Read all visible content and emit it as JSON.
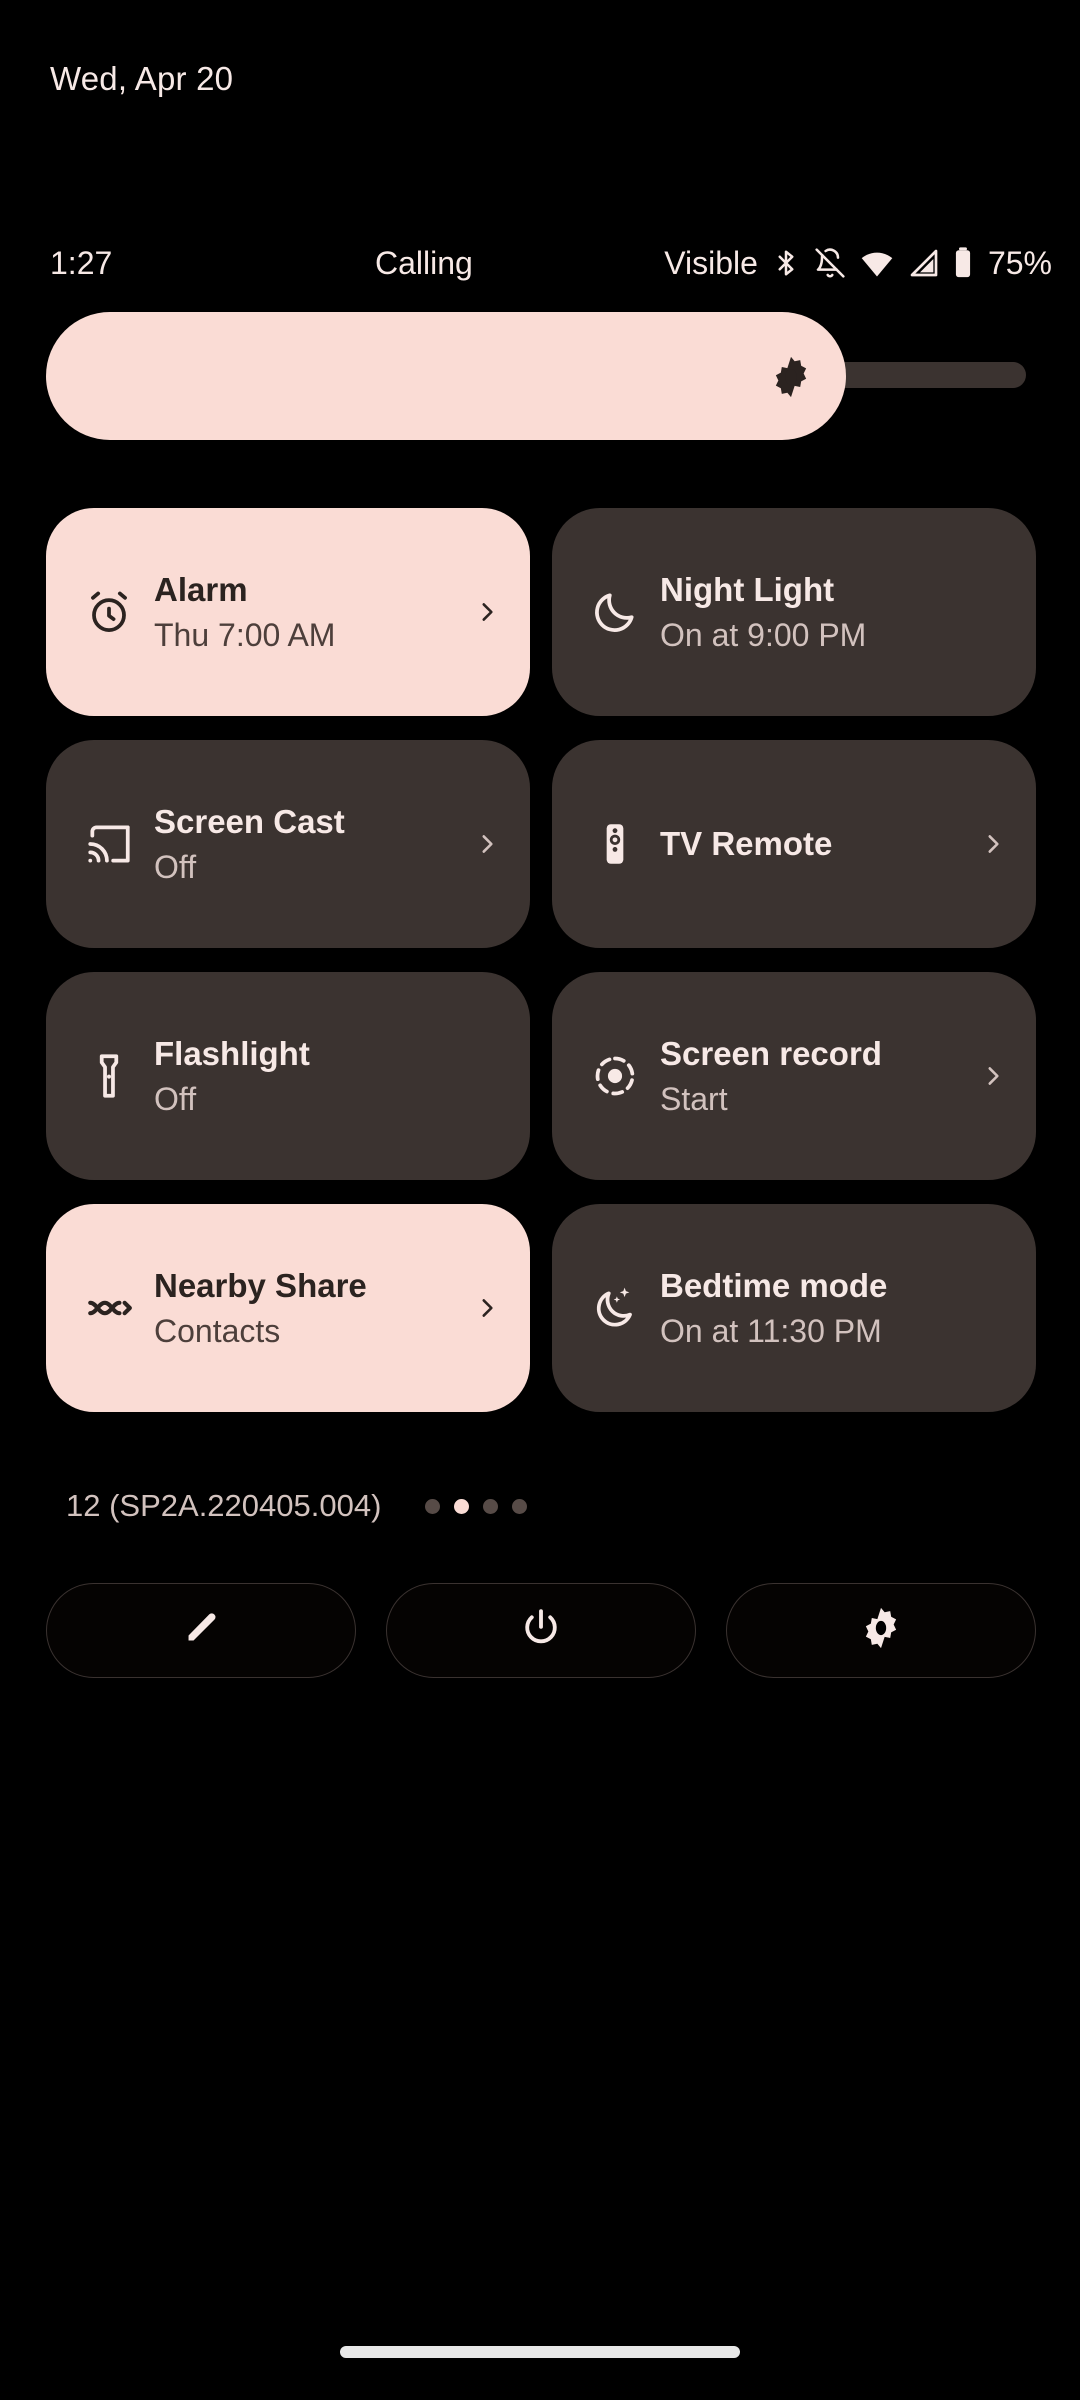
{
  "date_header": "Wed, Apr 20",
  "status_bar": {
    "clock": "1:27",
    "calling_label": "Calling",
    "carrier": "Visible",
    "battery_percent": "75%",
    "icons": [
      "bluetooth-icon",
      "notifications-muted-icon",
      "wifi-icon",
      "cellular-signal-icon",
      "battery-icon"
    ]
  },
  "brightness": {
    "icon": "brightness-icon",
    "value_percent": 80
  },
  "tiles": [
    {
      "label": "Alarm",
      "sub": "Thu 7:00 AM",
      "icon": "alarm-icon",
      "active": true,
      "chevron": true
    },
    {
      "label": "Night Light",
      "sub": "On at 9:00 PM",
      "icon": "moon-icon",
      "active": false,
      "chevron": false
    },
    {
      "label": "Screen Cast",
      "sub": "Off",
      "icon": "cast-icon",
      "active": false,
      "chevron": true
    },
    {
      "label": "TV Remote",
      "sub": "",
      "icon": "tv-remote-icon",
      "active": false,
      "chevron": true
    },
    {
      "label": "Flashlight",
      "sub": "Off",
      "icon": "flashlight-icon",
      "active": false,
      "chevron": false
    },
    {
      "label": "Screen record",
      "sub": "Start",
      "icon": "screen-record-icon",
      "active": false,
      "chevron": true
    },
    {
      "label": "Nearby Share",
      "sub": "Contacts",
      "icon": "nearby-share-icon",
      "active": true,
      "chevron": true
    },
    {
      "label": "Bedtime mode",
      "sub": "On at 11:30 PM",
      "icon": "bedtime-icon",
      "active": false,
      "chevron": false
    }
  ],
  "footer": {
    "build": "12 (SP2A.220405.004)",
    "page_dots": 4,
    "page_active_index": 1
  },
  "bottom_buttons": [
    {
      "name": "edit-button",
      "icon": "pencil-icon"
    },
    {
      "name": "power-button",
      "icon": "power-icon"
    },
    {
      "name": "settings-button",
      "icon": "gear-icon"
    }
  ],
  "colors": {
    "background": "#000000",
    "tile_active": "#FADCD5",
    "tile_inactive": "#3B3330",
    "text_primary": "#F7E9E6",
    "text_secondary": "#D2C2BE"
  }
}
